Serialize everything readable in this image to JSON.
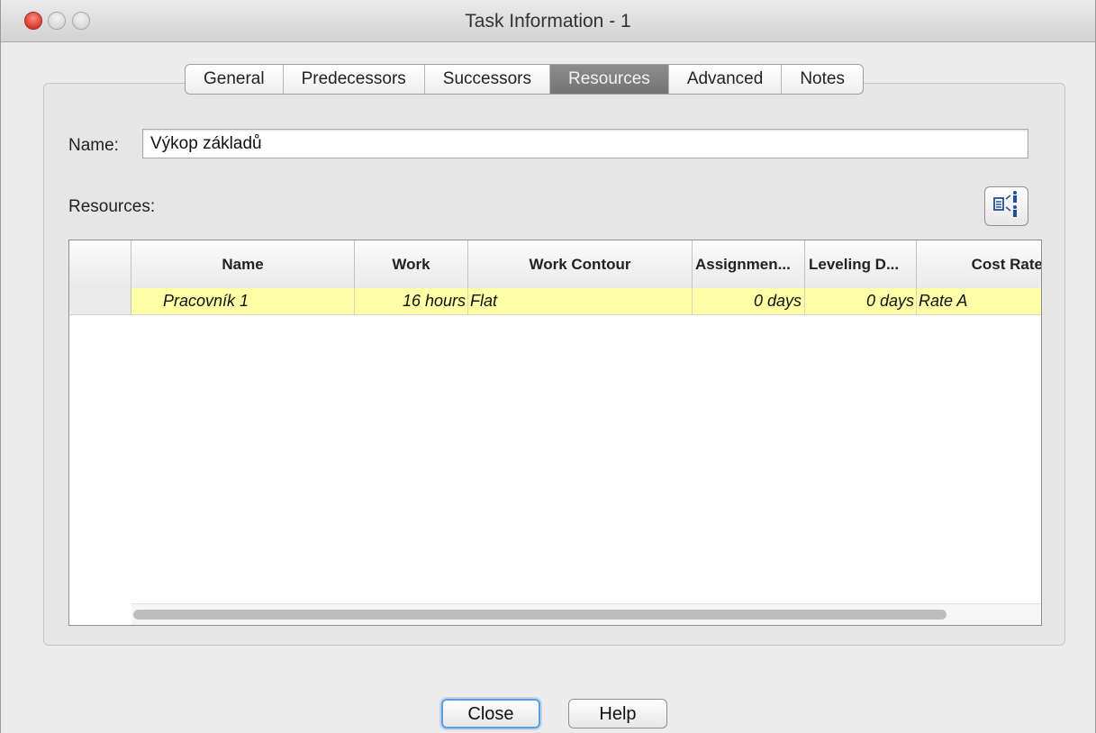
{
  "window": {
    "title": "Task Information - 1"
  },
  "tabs": [
    {
      "label": "General",
      "active": false
    },
    {
      "label": "Predecessors",
      "active": false
    },
    {
      "label": "Successors",
      "active": false
    },
    {
      "label": "Resources",
      "active": true
    },
    {
      "label": "Advanced",
      "active": false
    },
    {
      "label": "Notes",
      "active": false
    }
  ],
  "form": {
    "name_label": "Name:",
    "name_value": "Výkop základů",
    "resources_label": "Resources:",
    "assign_icon": "assign-resources-icon"
  },
  "table": {
    "columns": [
      "Name",
      "Work",
      "Work Contour",
      "Assignmen...",
      "Leveling D...",
      "Cost Rate"
    ],
    "rows": [
      {
        "name": "Pracovník 1",
        "work": "16 hours",
        "contour": "Flat",
        "assignment": "0 days",
        "leveling": "0 days",
        "cost_rate": "Rate A"
      }
    ],
    "row_color": "#ffffa8"
  },
  "buttons": {
    "close": "Close",
    "help": "Help"
  }
}
